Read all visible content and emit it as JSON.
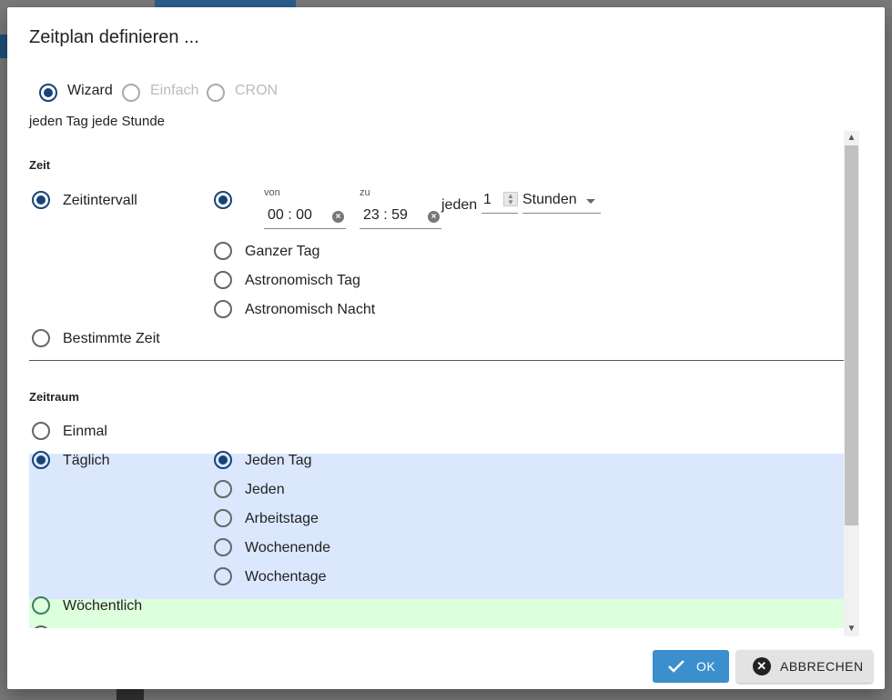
{
  "dialog": {
    "title": "Zeitplan definieren ...",
    "mode": {
      "options": [
        {
          "label": "Wizard",
          "selected": true,
          "disabled": false
        },
        {
          "label": "Einfach",
          "selected": false,
          "disabled": true
        },
        {
          "label": "CRON",
          "selected": false,
          "disabled": true
        }
      ]
    },
    "summary": "jeden Tag jede Stunde",
    "zeit": {
      "title": "Zeit",
      "intervall_label": "Zeitintervall",
      "von_label": "von",
      "von_value": "00 : 00",
      "zu_label": "zu",
      "zu_value": "23 : 59",
      "jeden_label": "jeden",
      "jeden_value": "1",
      "unit_value": "Stunden",
      "options": [
        "Ganzer Tag",
        "Astronomisch Tag",
        "Astronomisch Nacht"
      ],
      "bestimmte_label": "Bestimmte Zeit"
    },
    "zeitraum": {
      "title": "Zeitraum",
      "einmal_label": "Einmal",
      "taeglich_label": "Täglich",
      "taeglich_options": [
        "Jeden Tag",
        "Jeden",
        "Arbeitstage",
        "Wochenende",
        "Wochentage"
      ],
      "woechentlich_label": "Wöchentlich"
    },
    "buttons": {
      "ok_label": "OK",
      "cancel_label": "ABBRECHEN"
    }
  },
  "colors": {
    "accent": "#164477",
    "ok_button": "#3b8fcc",
    "taeglich_band": "#dbe7fd",
    "woechentlich_band": "#dcffdc"
  }
}
